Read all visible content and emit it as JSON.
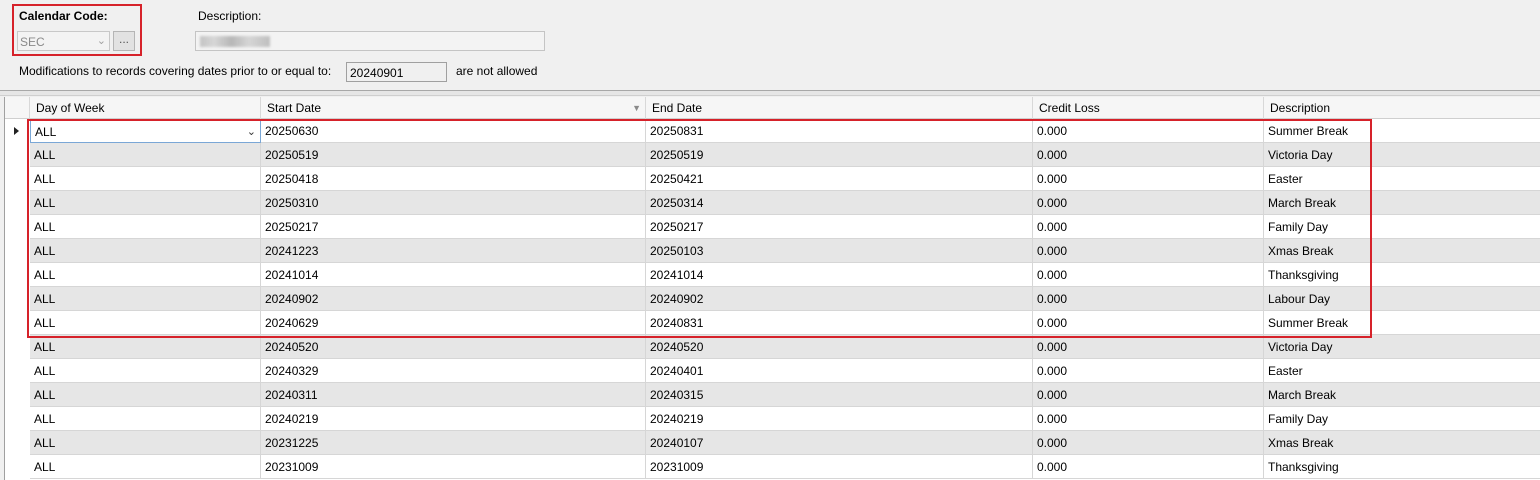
{
  "calendar": {
    "code_label": "Calendar Code:",
    "code_value": "SEC",
    "ellipsis_label": "...",
    "description_label": "Description:",
    "modifications_prefix": "Modifications to records covering dates prior to or equal to:",
    "modifications_date": "20240901",
    "modifications_suffix": "are not allowed"
  },
  "grid": {
    "columns": [
      "Day of Week",
      "Start Date",
      "End Date",
      "Credit Loss",
      "Description"
    ],
    "rows": [
      [
        "ALL",
        "20250630",
        "20250831",
        "0.000",
        "Summer Break"
      ],
      [
        "ALL",
        "20250519",
        "20250519",
        "0.000",
        "Victoria Day"
      ],
      [
        "ALL",
        "20250418",
        "20250421",
        "0.000",
        "Easter"
      ],
      [
        "ALL",
        "20250310",
        "20250314",
        "0.000",
        "March Break"
      ],
      [
        "ALL",
        "20250217",
        "20250217",
        "0.000",
        "Family Day"
      ],
      [
        "ALL",
        "20241223",
        "20250103",
        "0.000",
        "Xmas Break"
      ],
      [
        "ALL",
        "20241014",
        "20241014",
        "0.000",
        "Thanksgiving"
      ],
      [
        "ALL",
        "20240902",
        "20240902",
        "0.000",
        "Labour Day"
      ],
      [
        "ALL",
        "20240629",
        "20240831",
        "0.000",
        "Summer Break"
      ],
      [
        "ALL",
        "20240520",
        "20240520",
        "0.000",
        "Victoria Day"
      ],
      [
        "ALL",
        "20240329",
        "20240401",
        "0.000",
        "Easter"
      ],
      [
        "ALL",
        "20240311",
        "20240315",
        "0.000",
        "March Break"
      ],
      [
        "ALL",
        "20240219",
        "20240219",
        "0.000",
        "Family Day"
      ],
      [
        "ALL",
        "20231225",
        "20240107",
        "0.000",
        "Xmas Break"
      ],
      [
        "ALL",
        "20231009",
        "20231009",
        "0.000",
        "Thanksgiving"
      ]
    ]
  },
  "colors": {
    "highlight": "#d6222a",
    "alt_row": "#e6e6e6"
  },
  "icons": {
    "combo_dropdown": "chevron-down-icon",
    "sort": "sort-descending-icon",
    "current_row": "row-pointer-icon"
  }
}
